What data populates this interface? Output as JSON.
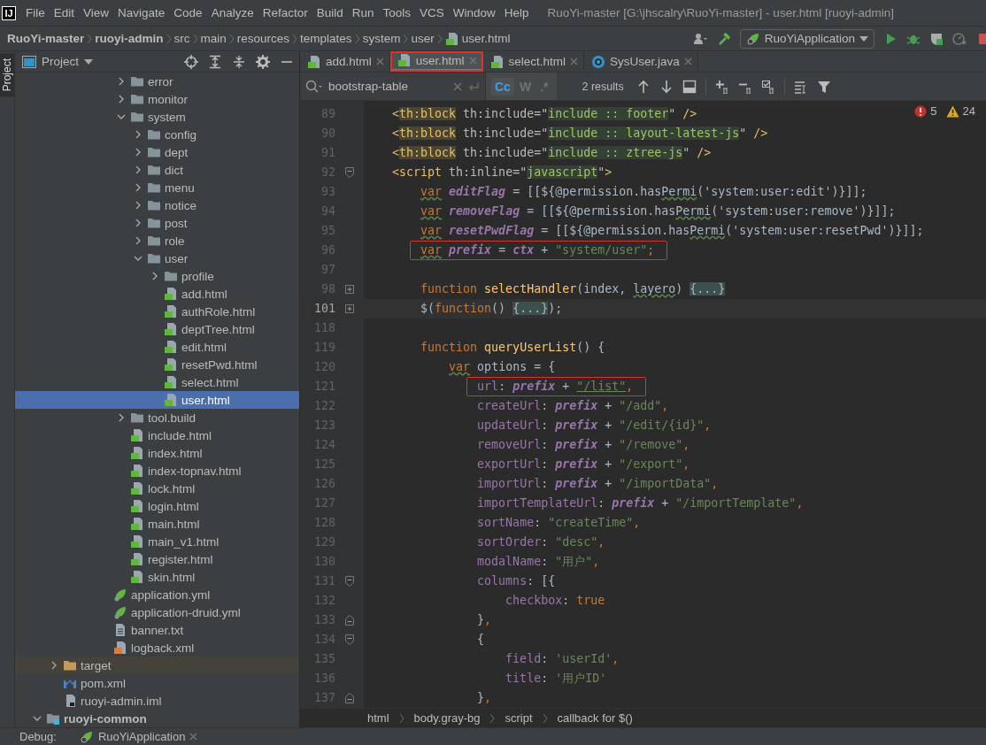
{
  "menu_bar": {
    "logo": "IJ",
    "items": [
      "File",
      "Edit",
      "View",
      "Navigate",
      "Code",
      "Analyze",
      "Refactor",
      "Build",
      "Run",
      "Tools",
      "VCS",
      "Window",
      "Help"
    ],
    "title": "RuoYi-master [G:\\jhscalry\\RuoYi-master] - user.html [ruoyi-admin]"
  },
  "navigation_bar": {
    "breadcrumbs": [
      {
        "label": "RuoYi-master",
        "kind": "project"
      },
      {
        "label": "ruoyi-admin",
        "kind": "module"
      },
      {
        "label": "src",
        "kind": "folder"
      },
      {
        "label": "main",
        "kind": "folder"
      },
      {
        "label": "resources",
        "kind": "folder"
      },
      {
        "label": "templates",
        "kind": "folder"
      },
      {
        "label": "system",
        "kind": "folder"
      },
      {
        "label": "user",
        "kind": "folder"
      },
      {
        "label": "user.html",
        "kind": "html"
      }
    ],
    "run_configuration": "RuoYiApplication"
  },
  "side_stripe": {
    "tab": "Project"
  },
  "project_panel": {
    "title": "Project",
    "tree": [
      {
        "children": [
          {
            "children": [
              {
                "children": [
                  {
                    "children": [
                      {
                        "children": [
                          {
                            "label": "error",
                            "kind": "folder",
                            "expanded": false,
                            "selected": false
                          },
                          {
                            "label": "monitor",
                            "kind": "folder",
                            "expanded": false,
                            "selected": false
                          },
                          {
                            "label": "system",
                            "kind": "folder",
                            "expanded": true,
                            "selected": false,
                            "children": [
                              {
                                "label": "config",
                                "kind": "folder",
                                "expanded": false,
                                "selected": false
                              },
                              {
                                "label": "dept",
                                "kind": "folder",
                                "expanded": false,
                                "selected": false
                              },
                              {
                                "label": "dict",
                                "kind": "folder",
                                "expanded": false,
                                "selected": false
                              },
                              {
                                "label": "menu",
                                "kind": "folder",
                                "expanded": false,
                                "selected": false
                              },
                              {
                                "label": "notice",
                                "kind": "folder",
                                "expanded": false,
                                "selected": false
                              },
                              {
                                "label": "post",
                                "kind": "folder",
                                "expanded": false,
                                "selected": false
                              },
                              {
                                "label": "role",
                                "kind": "folder",
                                "expanded": false,
                                "selected": false
                              },
                              {
                                "label": "user",
                                "kind": "folder",
                                "expanded": true,
                                "selected": false,
                                "children": [
                                  {
                                    "label": "profile",
                                    "kind": "folder",
                                    "expanded": false,
                                    "selected": false
                                  },
                                  {
                                    "label": "add.html",
                                    "kind": "html",
                                    "selected": false
                                  },
                                  {
                                    "label": "authRole.html",
                                    "kind": "html",
                                    "selected": false
                                  },
                                  {
                                    "label": "deptTree.html",
                                    "kind": "html",
                                    "selected": false
                                  },
                                  {
                                    "label": "edit.html",
                                    "kind": "html",
                                    "selected": false
                                  },
                                  {
                                    "label": "resetPwd.html",
                                    "kind": "html",
                                    "selected": false
                                  },
                                  {
                                    "label": "select.html",
                                    "kind": "html",
                                    "selected": false
                                  },
                                  {
                                    "label": "user.html",
                                    "kind": "html",
                                    "selected": true
                                  }
                                ]
                              }
                            ]
                          },
                          {
                            "label": "tool.build",
                            "kind": "folder",
                            "expanded": false,
                            "selected": false
                          },
                          {
                            "label": "include.html",
                            "kind": "html",
                            "selected": false
                          },
                          {
                            "label": "index.html",
                            "kind": "html",
                            "selected": false
                          },
                          {
                            "label": "index-topnav.html",
                            "kind": "html",
                            "selected": false
                          },
                          {
                            "label": "lock.html",
                            "kind": "html",
                            "selected": false
                          },
                          {
                            "label": "login.html",
                            "kind": "html",
                            "selected": false
                          },
                          {
                            "label": "main.html",
                            "kind": "html",
                            "selected": false
                          },
                          {
                            "label": "main_v1.html",
                            "kind": "html",
                            "selected": false
                          },
                          {
                            "label": "register.html",
                            "kind": "html",
                            "selected": false
                          },
                          {
                            "label": "skin.html",
                            "kind": "html",
                            "selected": false
                          }
                        ]
                      },
                      {
                        "label": "application.yml",
                        "kind": "yml",
                        "selected": false
                      },
                      {
                        "label": "application-druid.yml",
                        "kind": "yml",
                        "selected": false
                      },
                      {
                        "label": "banner.txt",
                        "kind": "txt",
                        "selected": false
                      },
                      {
                        "label": "logback.xml",
                        "kind": "xml",
                        "selected": false
                      }
                    ]
                  }
                ]
              }
            ]
          },
          {
            "label": "target",
            "kind": "excluded_folder",
            "expanded": false,
            "selected": false
          },
          {
            "label": "pom.xml",
            "kind": "maven",
            "selected": false
          },
          {
            "label": "ruoyi-admin.iml",
            "kind": "iml",
            "selected": false
          }
        ]
      },
      {
        "label": "ruoyi-common",
        "kind": "module",
        "expanded": true,
        "selected": false
      }
    ]
  },
  "editor": {
    "tabs": [
      {
        "label": "add.html",
        "kind": "html",
        "selected": false,
        "annotated": false
      },
      {
        "label": "user.html",
        "kind": "html",
        "selected": true,
        "annotated": true
      },
      {
        "label": "select.html",
        "kind": "html",
        "selected": false,
        "annotated": false
      },
      {
        "label": "SysUser.java",
        "kind": "java",
        "selected": false,
        "annotated": false
      }
    ],
    "search": {
      "value": "bootstrap-table",
      "options": [
        {
          "label": "Cc",
          "selected": true
        },
        {
          "label": "W",
          "selected": false
        },
        {
          "label": ".*",
          "selected": false
        }
      ],
      "results": "2 results"
    },
    "inspections": {
      "errors": "5",
      "warnings": "24"
    },
    "lines": [
      {
        "number": "89",
        "kind": "code",
        "current": false,
        "boxed": false,
        "tokens": [
          {
            "kind": "tag",
            "text": "    <"
          },
          {
            "kind": "tag_hl",
            "text": "th:block"
          },
          {
            "kind": "attr",
            "text": " th:include=\""
          },
          {
            "kind": "attr_value",
            "text": "include :: footer"
          },
          {
            "kind": "attr",
            "text": "\""
          },
          {
            "kind": "tag",
            "text": " />"
          }
        ]
      },
      {
        "number": "90",
        "kind": "code",
        "current": false,
        "boxed": false,
        "tokens": [
          {
            "kind": "tag",
            "text": "    <"
          },
          {
            "kind": "tag_hl",
            "text": "th:block"
          },
          {
            "kind": "attr",
            "text": " th:include=\""
          },
          {
            "kind": "attr_value",
            "text": "include :: layout-latest-js"
          },
          {
            "kind": "attr",
            "text": "\""
          },
          {
            "kind": "tag",
            "text": " />"
          }
        ]
      },
      {
        "number": "91",
        "kind": "code",
        "current": false,
        "boxed": false,
        "tokens": [
          {
            "kind": "tag",
            "text": "    <"
          },
          {
            "kind": "tag_hl",
            "text": "th:block"
          },
          {
            "kind": "attr",
            "text": " th:include=\""
          },
          {
            "kind": "attr_value",
            "text": "include :: ztree-js"
          },
          {
            "kind": "attr",
            "text": "\""
          },
          {
            "kind": "tag",
            "text": " />"
          }
        ]
      },
      {
        "number": "92",
        "kind": "fold_start",
        "current": false,
        "boxed": false,
        "tokens": [
          {
            "kind": "tag",
            "text": "    <script"
          },
          {
            "kind": "attr",
            "text": " th:inline=\""
          },
          {
            "kind": "attr_value",
            "text": "javascript"
          },
          {
            "kind": "attr",
            "text": "\""
          },
          {
            "kind": "tag",
            "text": ">"
          }
        ]
      },
      {
        "number": "93",
        "kind": "code",
        "current": false,
        "boxed": false,
        "tokens": [
          {
            "kind": "keyword_warn",
            "text": "        var"
          },
          {
            "kind": "var_italic",
            "text": " editFlag"
          },
          {
            "kind": "plain",
            "text": " = [[${@permission.has"
          },
          {
            "kind": "plain_warn",
            "text": "Permi"
          },
          {
            "kind": "plain",
            "text": "('system:user:edit')}]];"
          }
        ]
      },
      {
        "number": "94",
        "kind": "code",
        "current": false,
        "boxed": false,
        "tokens": [
          {
            "kind": "keyword_warn",
            "text": "        var"
          },
          {
            "kind": "var_italic",
            "text": " removeFlag"
          },
          {
            "kind": "plain",
            "text": " = [[${@permission.has"
          },
          {
            "kind": "plain_warn",
            "text": "Permi"
          },
          {
            "kind": "plain",
            "text": "('system:user:remove')}]];"
          }
        ]
      },
      {
        "number": "95",
        "kind": "code",
        "current": false,
        "boxed": false,
        "tokens": [
          {
            "kind": "keyword_warn",
            "text": "        var"
          },
          {
            "kind": "var_italic",
            "text": " resetPwdFlag"
          },
          {
            "kind": "plain",
            "text": " = [[${@permission.has"
          },
          {
            "kind": "plain_warn",
            "text": "Permi"
          },
          {
            "kind": "plain",
            "text": "('system:user:resetPwd')}]];"
          }
        ]
      },
      {
        "number": "96",
        "kind": "code",
        "current": false,
        "boxed": true,
        "tokens": [
          {
            "kind": "keyword_warn",
            "text": "        var"
          },
          {
            "kind": "var_italic",
            "text": " prefix"
          },
          {
            "kind": "plain",
            "text": " = "
          },
          {
            "kind": "var_italic",
            "text": "ctx"
          },
          {
            "kind": "plain",
            "text": " + "
          },
          {
            "kind": "string",
            "text": "\"system/user\""
          },
          {
            "kind": "keyword",
            "text": ";"
          }
        ]
      },
      {
        "number": "97",
        "kind": "code",
        "current": false,
        "boxed": false
      },
      {
        "number": "98",
        "kind": "collapsed",
        "current": false,
        "boxed": false,
        "tokens": [
          {
            "kind": "keyword",
            "text": "        function"
          },
          {
            "kind": "function",
            "text": " selectHandler"
          },
          {
            "kind": "plain",
            "text": "(index, "
          },
          {
            "kind": "plain_warn",
            "text": "layero"
          },
          {
            "kind": "plain",
            "text": ") "
          },
          {
            "kind": "folded",
            "text": "{...}"
          }
        ]
      },
      {
        "number": "101",
        "kind": "collapsed",
        "current": true,
        "boxed": false,
        "tokens": [
          {
            "kind": "plain",
            "text": "        $("
          },
          {
            "kind": "keyword",
            "text": "function"
          },
          {
            "kind": "plain",
            "text": "() "
          },
          {
            "kind": "folded",
            "text": "{...}"
          },
          {
            "kind": "plain",
            "text": ");"
          }
        ]
      },
      {
        "number": "118",
        "kind": "code",
        "current": false,
        "boxed": false
      },
      {
        "number": "119",
        "kind": "code",
        "current": false,
        "boxed": false,
        "tokens": [
          {
            "kind": "keyword",
            "text": "        function"
          },
          {
            "kind": "function",
            "text": " queryUserList"
          },
          {
            "kind": "plain",
            "text": "() {"
          }
        ]
      },
      {
        "number": "120",
        "kind": "code",
        "current": false,
        "boxed": false,
        "tokens": [
          {
            "kind": "keyword_warn",
            "text": "            var"
          },
          {
            "kind": "plain",
            "text": " options = {"
          }
        ]
      },
      {
        "number": "121",
        "kind": "code",
        "current": false,
        "boxed": true,
        "tokens": [
          {
            "kind": "field",
            "text": "                url"
          },
          {
            "kind": "plain",
            "text": ": "
          },
          {
            "kind": "var_italic",
            "text": "prefix"
          },
          {
            "kind": "plain",
            "text": " + "
          },
          {
            "kind": "string_link",
            "text": "\"/list\""
          },
          {
            "kind": "keyword",
            "text": ","
          }
        ]
      },
      {
        "number": "122",
        "kind": "code",
        "current": false,
        "boxed": false,
        "tokens": [
          {
            "kind": "field",
            "text": "                createUrl"
          },
          {
            "kind": "plain",
            "text": ": "
          },
          {
            "kind": "var_italic",
            "text": "prefix"
          },
          {
            "kind": "plain",
            "text": " + "
          },
          {
            "kind": "string",
            "text": "\"/add\""
          },
          {
            "kind": "keyword",
            "text": ","
          }
        ]
      },
      {
        "number": "123",
        "kind": "code",
        "current": false,
        "boxed": false,
        "tokens": [
          {
            "kind": "field",
            "text": "                updateUrl"
          },
          {
            "kind": "plain",
            "text": ": "
          },
          {
            "kind": "var_italic",
            "text": "prefix"
          },
          {
            "kind": "plain",
            "text": " + "
          },
          {
            "kind": "string",
            "text": "\"/edit/{id}\""
          },
          {
            "kind": "keyword",
            "text": ","
          }
        ]
      },
      {
        "number": "124",
        "kind": "code",
        "current": false,
        "boxed": false,
        "tokens": [
          {
            "kind": "field",
            "text": "                removeUrl"
          },
          {
            "kind": "plain",
            "text": ": "
          },
          {
            "kind": "var_italic",
            "text": "prefix"
          },
          {
            "kind": "plain",
            "text": " + "
          },
          {
            "kind": "string",
            "text": "\"/remove\""
          },
          {
            "kind": "keyword",
            "text": ","
          }
        ]
      },
      {
        "number": "125",
        "kind": "code",
        "current": false,
        "boxed": false,
        "tokens": [
          {
            "kind": "field",
            "text": "                exportUrl"
          },
          {
            "kind": "plain",
            "text": ": "
          },
          {
            "kind": "var_italic",
            "text": "prefix"
          },
          {
            "kind": "plain",
            "text": " + "
          },
          {
            "kind": "string",
            "text": "\"/export\""
          },
          {
            "kind": "keyword",
            "text": ","
          }
        ]
      },
      {
        "number": "126",
        "kind": "code",
        "current": false,
        "boxed": false,
        "tokens": [
          {
            "kind": "field",
            "text": "                importUrl"
          },
          {
            "kind": "plain",
            "text": ": "
          },
          {
            "kind": "var_italic",
            "text": "prefix"
          },
          {
            "kind": "plain",
            "text": " + "
          },
          {
            "kind": "string",
            "text": "\"/importData\""
          },
          {
            "kind": "keyword",
            "text": ","
          }
        ]
      },
      {
        "number": "127",
        "kind": "code",
        "current": false,
        "boxed": false,
        "tokens": [
          {
            "kind": "field",
            "text": "                importTemplateUrl"
          },
          {
            "kind": "plain",
            "text": ": "
          },
          {
            "kind": "var_italic",
            "text": "prefix"
          },
          {
            "kind": "plain",
            "text": " + "
          },
          {
            "kind": "string",
            "text": "\"/importTemplate\""
          },
          {
            "kind": "keyword",
            "text": ","
          }
        ]
      },
      {
        "number": "128",
        "kind": "code",
        "current": false,
        "boxed": false,
        "tokens": [
          {
            "kind": "field",
            "text": "                sortName"
          },
          {
            "kind": "plain",
            "text": ": "
          },
          {
            "kind": "string",
            "text": "\"createTime\""
          },
          {
            "kind": "keyword",
            "text": ","
          }
        ]
      },
      {
        "number": "129",
        "kind": "code",
        "current": false,
        "boxed": false,
        "tokens": [
          {
            "kind": "field",
            "text": "                sortOrder"
          },
          {
            "kind": "plain",
            "text": ": "
          },
          {
            "kind": "string",
            "text": "\"desc\""
          },
          {
            "kind": "keyword",
            "text": ","
          }
        ]
      },
      {
        "number": "130",
        "kind": "code",
        "current": false,
        "boxed": false,
        "tokens": [
          {
            "kind": "field",
            "text": "                modalName"
          },
          {
            "kind": "plain",
            "text": ": "
          },
          {
            "kind": "string",
            "text": "\"用户\""
          },
          {
            "kind": "keyword",
            "text": ","
          }
        ]
      },
      {
        "number": "131",
        "kind": "fold_start",
        "current": false,
        "boxed": false,
        "tokens": [
          {
            "kind": "field",
            "text": "                columns"
          },
          {
            "kind": "plain",
            "text": ": [{"
          }
        ]
      },
      {
        "number": "132",
        "kind": "code",
        "current": false,
        "boxed": false,
        "tokens": [
          {
            "kind": "field",
            "text": "                    checkbox"
          },
          {
            "kind": "plain",
            "text": ": "
          },
          {
            "kind": "keyword",
            "text": "true"
          }
        ]
      },
      {
        "number": "133",
        "kind": "fold_end",
        "current": false,
        "boxed": false,
        "tokens": [
          {
            "kind": "plain",
            "text": "                }"
          },
          {
            "kind": "keyword",
            "text": ","
          }
        ]
      },
      {
        "number": "134",
        "kind": "fold_start",
        "current": false,
        "boxed": false,
        "tokens": [
          {
            "kind": "plain",
            "text": "                {"
          }
        ]
      },
      {
        "number": "135",
        "kind": "code",
        "current": false,
        "boxed": false,
        "tokens": [
          {
            "kind": "field",
            "text": "                    field"
          },
          {
            "kind": "plain",
            "text": ": "
          },
          {
            "kind": "string",
            "text": "'userId'"
          },
          {
            "kind": "keyword",
            "text": ","
          }
        ]
      },
      {
        "number": "136",
        "kind": "code",
        "current": false,
        "boxed": false,
        "tokens": [
          {
            "kind": "field",
            "text": "                    title"
          },
          {
            "kind": "plain",
            "text": ": "
          },
          {
            "kind": "string",
            "text": "'用户ID'"
          }
        ]
      },
      {
        "number": "137",
        "kind": "fold_end",
        "current": false,
        "boxed": false,
        "tokens": [
          {
            "kind": "plain",
            "text": "                }"
          },
          {
            "kind": "keyword",
            "text": ","
          }
        ]
      }
    ],
    "breadcrumbs": [
      "html",
      "body.gray-bg",
      "script",
      "callback for $()"
    ]
  },
  "debug_bar": {
    "label": "Debug:",
    "tab": "RuoYiApplication"
  }
}
